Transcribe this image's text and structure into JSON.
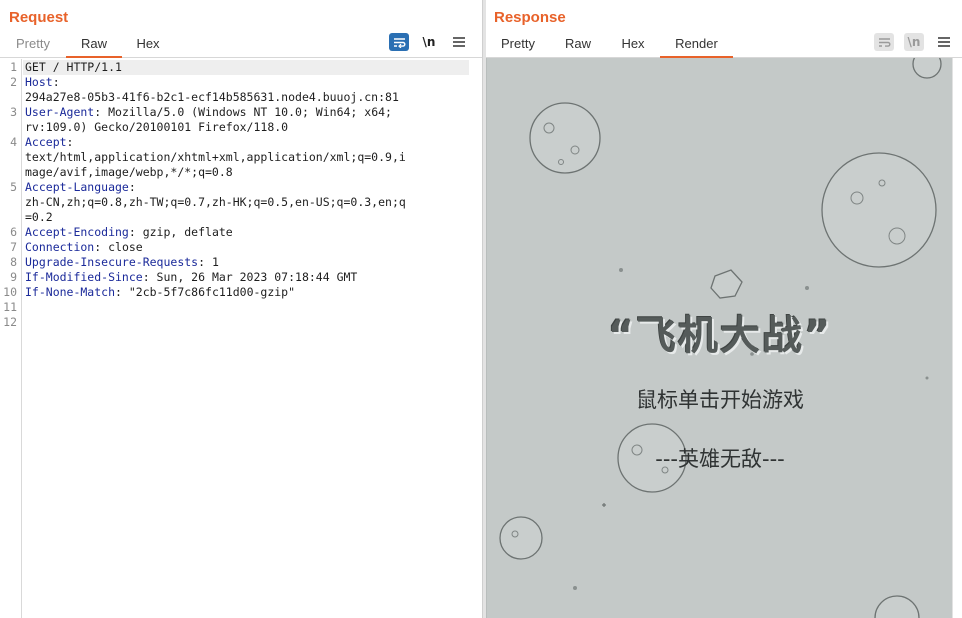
{
  "request": {
    "title": "Request",
    "tabs": [
      "Pretty",
      "Raw",
      "Hex"
    ],
    "active_tab": "Raw",
    "tools": {
      "wrap": "wrap-icon",
      "newline": "\\n",
      "menu": "hamburger-menu-icon"
    },
    "line_numbers": [
      "1",
      "2",
      "3",
      "4",
      "5",
      "6",
      "7",
      "8",
      "9",
      "10",
      "11",
      "12"
    ],
    "lines": [
      {
        "key": "",
        "text": "GET / HTTP/1.1"
      },
      {
        "key": "Host",
        "text": ":"
      },
      {
        "key": "",
        "text": "294a27e8-05b3-41f6-b2c1-ecf14b585631.node4.buuoj.cn:81"
      },
      {
        "key": "User-Agent",
        "text": ": Mozilla/5.0 (Windows NT 10.0; Win64; x64;"
      },
      {
        "key": "",
        "text": "rv:109.0) Gecko/20100101 Firefox/118.0"
      },
      {
        "key": "Accept",
        "text": ":"
      },
      {
        "key": "",
        "text": "text/html,application/xhtml+xml,application/xml;q=0.9,i"
      },
      {
        "key": "",
        "text": "mage/avif,image/webp,*/*;q=0.8"
      },
      {
        "key": "Accept-Language",
        "text": ":"
      },
      {
        "key": "",
        "text": "zh-CN,zh;q=0.8,zh-TW;q=0.7,zh-HK;q=0.5,en-US;q=0.3,en;q"
      },
      {
        "key": "",
        "text": "=0.2"
      },
      {
        "key": "Accept-Encoding",
        "text": ": gzip, deflate"
      },
      {
        "key": "Connection",
        "text": ": close"
      },
      {
        "key": "Upgrade-Insecure-Requests",
        "text": ": 1"
      },
      {
        "key": "If-Modified-Since",
        "text": ": Sun, 26 Mar 2023 07:18:44 GMT"
      },
      {
        "key": "If-None-Match",
        "text": ": \"2cb-5f7c86fc11d00-gzip\""
      }
    ]
  },
  "response": {
    "title": "Response",
    "tabs": [
      "Pretty",
      "Raw",
      "Hex",
      "Render"
    ],
    "active_tab": "Render",
    "render": {
      "title": "“飞机大战”",
      "subtitle": "鼠标单击开始游戏",
      "mode": "---英雄无敌---"
    }
  },
  "colors": {
    "accent": "#e8622a",
    "header_key": "#1b2a9a",
    "render_bg": "#c4c9c8",
    "wrap_active": "#2a6fb3"
  }
}
